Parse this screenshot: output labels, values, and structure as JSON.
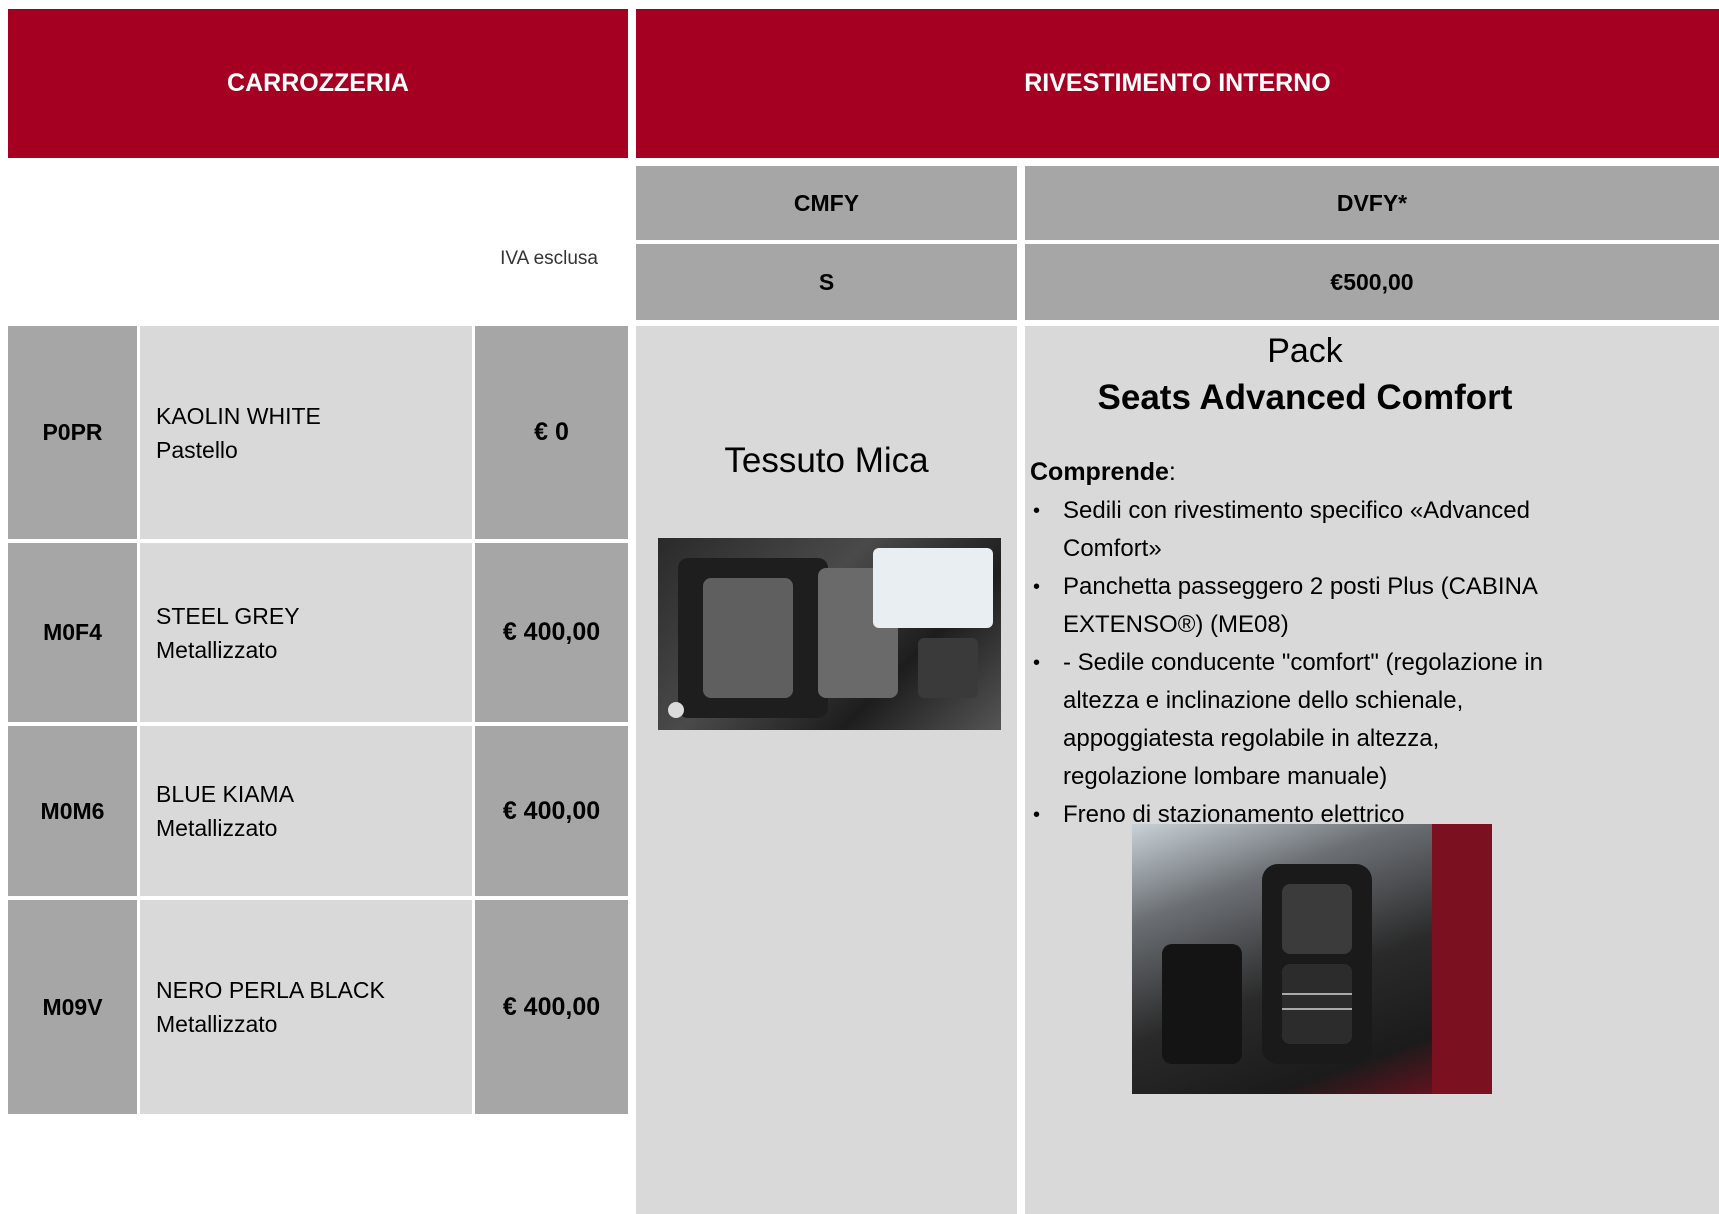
{
  "header": {
    "left_title": "CARROZZERIA",
    "right_title": "RIVESTIMENTO INTERNO"
  },
  "iva_note": "IVA esclusa",
  "interior_columns": [
    {
      "code": "CMFY",
      "price": "S"
    },
    {
      "code": "DVFY*",
      "price": "€500,00"
    }
  ],
  "colors": [
    {
      "code": "P0PR",
      "name": "KAOLIN WHITE",
      "type": "Pastello",
      "price": "€ 0"
    },
    {
      "code": "M0F4",
      "name": "STEEL GREY",
      "type": "Metallizzato",
      "price": "€ 400,00"
    },
    {
      "code": "M0M6",
      "name": "BLUE KIAMA",
      "type": "Metallizzato",
      "price": "€ 400,00"
    },
    {
      "code": "M09V",
      "name": "NERO PERLA BLACK",
      "type": "Metallizzato",
      "price": "€ 400,00"
    }
  ],
  "cmfy": {
    "name": "Tessuto Mica"
  },
  "dvfy": {
    "pack_title": "Pack",
    "pack_subtitle": "Seats Advanced Comfort",
    "includes_label": "Comprende",
    "includes_colon": ":",
    "features": [
      "Sedili con rivestimento specifico «Advanced Comfort»",
      "Panchetta passeggero 2 posti Plus (CABINA EXTENSO®) (ME08)",
      "- Sedile conducente \"comfort\" (regolazione in altezza e inclinazione dello schienale, appoggiatesta regolabile in altezza, regolazione lombare manuale)",
      "Freno di stazionamento elettrico"
    ]
  },
  "colors_palette": {
    "brand_red": "#a50021",
    "header_grey": "#a6a6a6",
    "cell_grey": "#d9d9d9"
  }
}
